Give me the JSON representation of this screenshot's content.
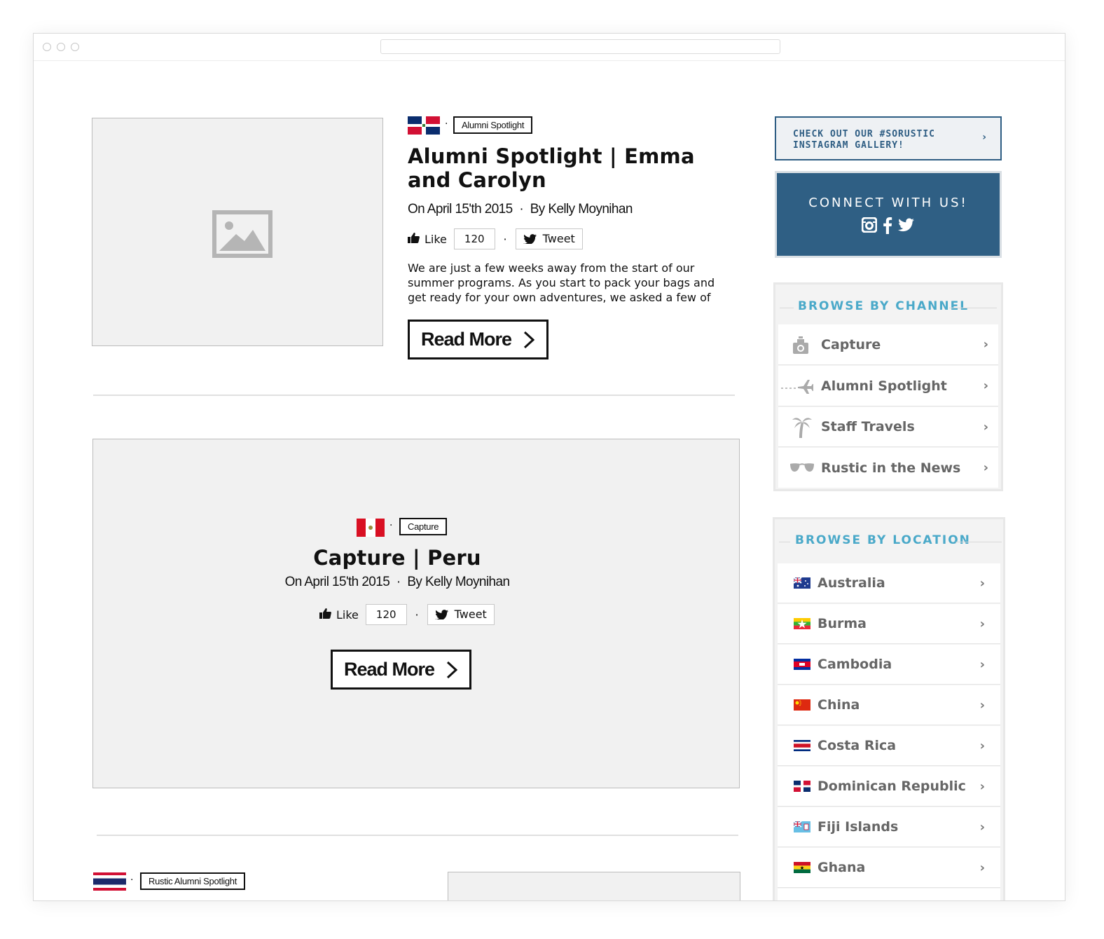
{
  "posts": [
    {
      "tag": "Alumni Spotlight",
      "title_line1": "Alumni Spotlight | Emma",
      "title_line2": "and Carolyn",
      "date": "On April 15'th 2015",
      "author": "By Kelly Moynihan",
      "like_label": "Like",
      "like_count": "120",
      "tweet_label": "Tweet",
      "excerpt_line1": "We are just a few weeks away from the start of our",
      "excerpt_line2": "summer programs. As you start to pack your bags and",
      "excerpt_line3": "get ready for your own adventures, we asked a few of",
      "read_more": "Read More"
    },
    {
      "tag": "Capture",
      "title": "Capture | Peru",
      "date": "On April 15'th 2015",
      "author": "By Kelly Moynihan",
      "like_label": "Like",
      "like_count": "120",
      "tweet_label": "Tweet",
      "read_more": "Read More"
    },
    {
      "tag": "Rustic Alumni Spotlight"
    }
  ],
  "sidebar": {
    "instagram_line1": "CHECK OUT OUR #SORUSTIC",
    "instagram_line2": "INSTAGRAM GALLERY!",
    "connect_label": "CONNECT WITH US!",
    "channel_heading": "BROWSE BY CHANNEL",
    "channels": [
      {
        "label": "Capture",
        "icon": "camera-icon"
      },
      {
        "label": "Alumni Spotlight",
        "icon": "airplane-icon"
      },
      {
        "label": "Staff Travels",
        "icon": "palm-tree-icon"
      },
      {
        "label": "Rustic in the News",
        "icon": "sunglasses-icon"
      }
    ],
    "location_heading": "BROWSE BY LOCATION",
    "locations": [
      {
        "label": "Australia"
      },
      {
        "label": "Burma"
      },
      {
        "label": "Cambodia"
      },
      {
        "label": "China"
      },
      {
        "label": "Costa Rica"
      },
      {
        "label": "Dominican Republic"
      },
      {
        "label": "Fiji Islands"
      },
      {
        "label": "Ghana"
      }
    ]
  },
  "colors": {
    "accent_blue": "#2f5f84",
    "heading_cyan": "#4aa9c9"
  }
}
